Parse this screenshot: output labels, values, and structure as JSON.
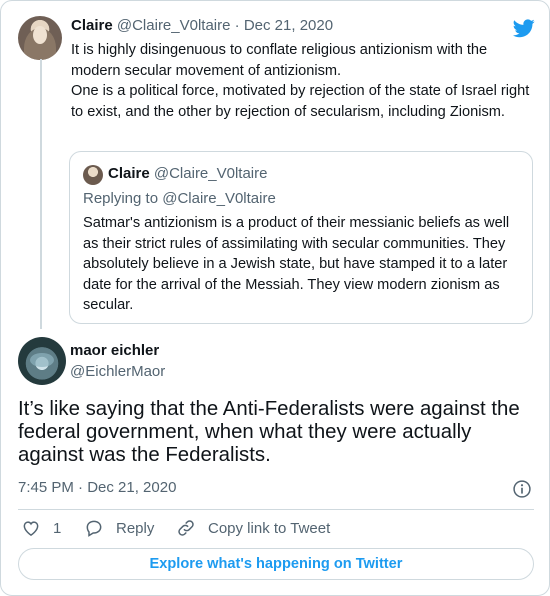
{
  "parent_tweet": {
    "name": "Claire",
    "handle": "@Claire_V0ltaire",
    "date": "Dec 21, 2020",
    "separator": "·",
    "lines": [
      "It is highly disingenuous to conflate religious antizionism with the modern secular movement of antizionism.",
      "One is a political force, motivated by rejection of the state of Israel right to exist, and the other by rejection of secularism, including Zionism."
    ]
  },
  "quoted_tweet": {
    "name": "Claire",
    "handle": "@Claire_V0ltaire",
    "replying_to": "Replying to @Claire_V0ltaire",
    "text": "Satmar's antizionism is a product of their messianic beliefs as well as their strict rules of assimilating with secular communities. They absolutely believe in a Jewish state, but have stamped it to a later date for the arrival of the Messiah. They view modern zionism as secular."
  },
  "main_tweet": {
    "name": "maor eichler",
    "handle": "@EichlerMaor",
    "text": "It’s like saying that the Anti-Federalists were against the federal government, when what they were actually against was the Federalists.",
    "timestamp": "7:45 PM · Dec 21, 2020"
  },
  "actions": {
    "like_count": "1",
    "reply_label": "Reply",
    "copy_link_label": "Copy link to Tweet"
  },
  "footer": {
    "explore_label": "Explore what's happening on Twitter"
  },
  "icons": {
    "brand": "twitter-bird-icon",
    "info": "info-icon",
    "like": "heart-icon",
    "reply": "reply-bubble-icon",
    "link": "link-icon"
  },
  "colors": {
    "brand_blue": "#1d9bf0",
    "secondary_text": "#536471",
    "border": "#cfd9de"
  }
}
